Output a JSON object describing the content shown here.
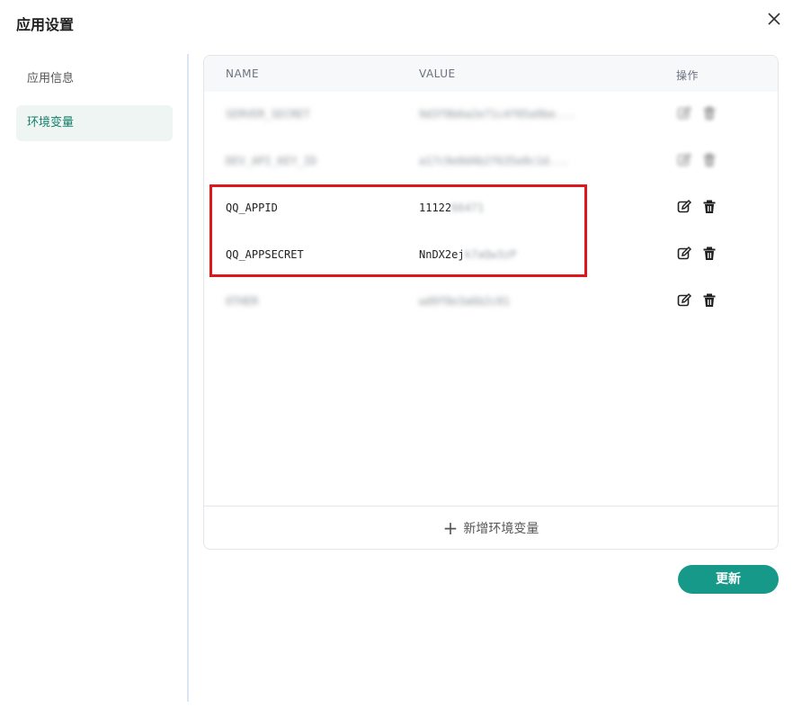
{
  "dialog": {
    "title": "应用设置",
    "close_icon": "close-icon"
  },
  "sidebar": {
    "items": [
      {
        "label": "应用信息",
        "active": false
      },
      {
        "label": "环境变量",
        "active": true
      }
    ]
  },
  "table": {
    "headers": {
      "name": "NAME",
      "value": "VALUE",
      "actions": "操作"
    },
    "rows": [
      {
        "name": "SERVER_SECRET",
        "value": "9d3f8b6a2e71c4f05a9be...",
        "blurred": true
      },
      {
        "name": "DEV_API_KEY_ID",
        "value": "a17c9e0d4b2f635e8c1d...",
        "blurred": true
      },
      {
        "name": "QQ_APPID",
        "value_visible": "11122",
        "value_hidden": "66471",
        "blurred": false
      },
      {
        "name": "QQ_APPSECRET",
        "value_visible": "NnDX2ej",
        "value_hidden": "k7aQw3zP",
        "blurred": false
      },
      {
        "name": "OTHER",
        "value": "wd9f8e3a6b2c01",
        "blurred": true
      }
    ],
    "action_icons": {
      "edit": "edit-icon",
      "delete": "trash-icon"
    },
    "add_label": "新增环境变量"
  },
  "footer": {
    "update_label": "更新"
  },
  "colors": {
    "accent": "#17998a",
    "active_text": "#14806a",
    "highlight_border": "#e0161d"
  }
}
